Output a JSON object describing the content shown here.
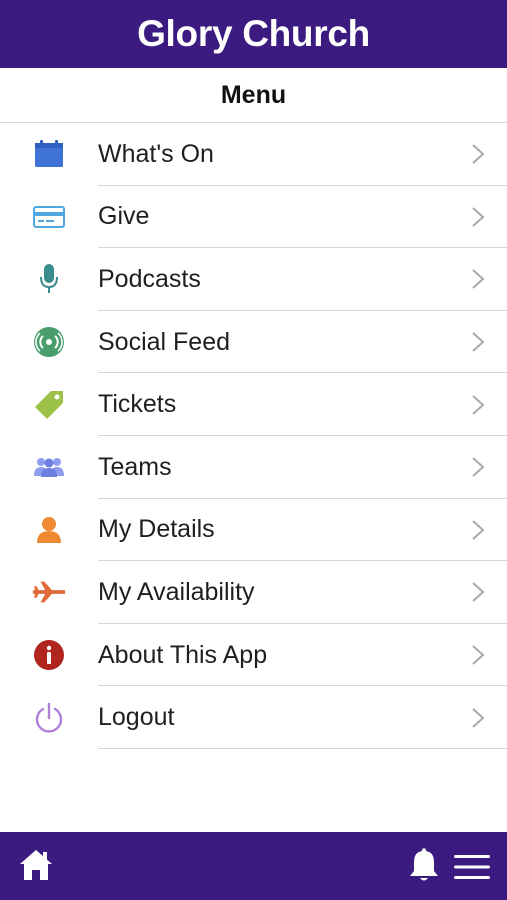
{
  "header": {
    "title": "Glory Church"
  },
  "menu": {
    "title": "Menu",
    "items": [
      {
        "label": "What's On",
        "icon": "calendar-icon",
        "color": "#3f74d6"
      },
      {
        "label": "Give",
        "icon": "credit-card-icon",
        "color": "#4fa8e0"
      },
      {
        "label": "Podcasts",
        "icon": "microphone-icon",
        "color": "#3b8c8c"
      },
      {
        "label": "Social Feed",
        "icon": "broadcast-icon",
        "color": "#4a9e6e"
      },
      {
        "label": "Tickets",
        "icon": "tag-icon",
        "color": "#9cc24a"
      },
      {
        "label": "Teams",
        "icon": "people-icon",
        "color": "#6c7fe0"
      },
      {
        "label": "My Details",
        "icon": "person-icon",
        "color": "#ef8a32"
      },
      {
        "label": "My Availability",
        "icon": "airplane-icon",
        "color": "#e06a3a"
      },
      {
        "label": "About This App",
        "icon": "info-icon",
        "color": "#b0261f"
      },
      {
        "label": "Logout",
        "icon": "power-icon",
        "color": "#b07fd8"
      }
    ]
  },
  "footer": {
    "home_icon": "home-icon",
    "notifications_icon": "bell-icon",
    "menu_icon": "hamburger-menu-icon",
    "bar_color": "#3b1b80"
  }
}
